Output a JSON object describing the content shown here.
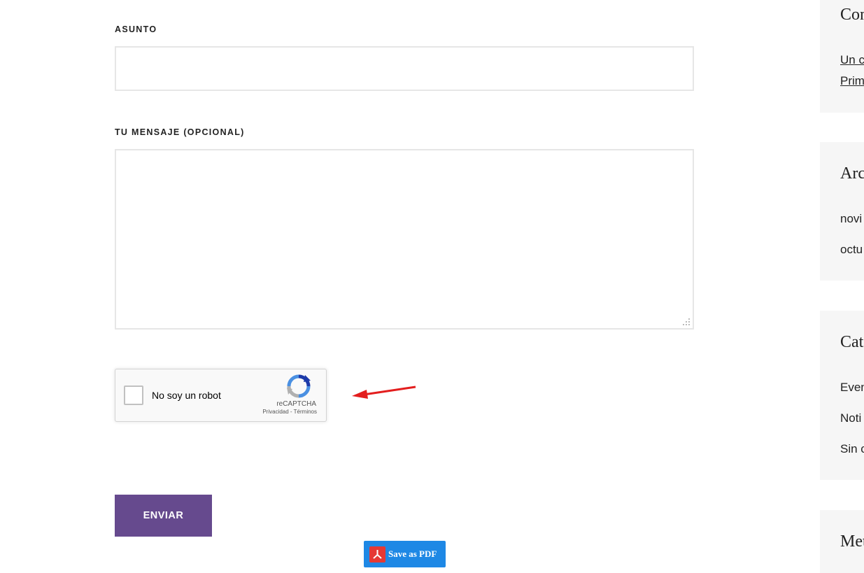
{
  "form": {
    "subject_label": "ASUNTO",
    "subject_value": "",
    "message_label": "TU MENSAJE (OPCIONAL)",
    "message_value": "",
    "recaptcha": {
      "label": "No soy un robot",
      "brand": "reCAPTCHA",
      "links": "Privacidad - Términos"
    },
    "submit_label": "ENVIAR"
  },
  "pdf_button": {
    "label": "Save as PDF"
  },
  "sidebar": {
    "widgets": [
      {
        "title": "Com",
        "items": [
          "Un c",
          "Prim"
        ]
      },
      {
        "title": "Arc",
        "items": [
          "novi",
          "octu"
        ]
      },
      {
        "title": "Cat",
        "items": [
          "Even",
          "Noti",
          "Sin c"
        ]
      },
      {
        "title": "Met",
        "items": []
      }
    ]
  },
  "colors": {
    "submit_bg": "#664a8e",
    "pdf_bg": "#1e88e5",
    "arrow": "#e31e1e"
  }
}
